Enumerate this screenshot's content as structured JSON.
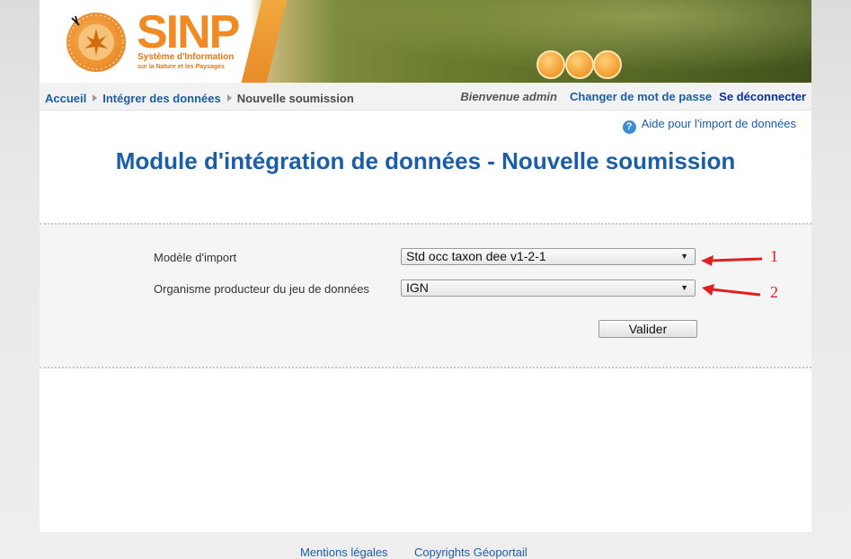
{
  "banner": {
    "logo_text": "SINP",
    "logo_subtitle": "Système d'Information",
    "logo_tagline": "sur la Nature et les Paysages",
    "brand_color": "#f08a24"
  },
  "breadcrumb": {
    "items": [
      {
        "label": "Accueil"
      },
      {
        "label": "Intégrer des données"
      }
    ],
    "current": "Nouvelle soumission"
  },
  "user": {
    "welcome": "Bienvenue admin",
    "change_password": "Changer de mot de passe",
    "logout": "Se déconnecter"
  },
  "help": {
    "label": "Aide pour l'import de données",
    "icon": "help-circle-icon"
  },
  "page": {
    "title": "Module d'intégration de données - Nouvelle soumission"
  },
  "form": {
    "import_model": {
      "label": "Modèle d'import",
      "value": "Std occ taxon dee v1-2-1"
    },
    "producer": {
      "label": "Organisme producteur du jeu de données",
      "value": "IGN"
    },
    "submit_label": "Valider"
  },
  "annotations": [
    "1",
    "2"
  ],
  "footer": {
    "legal": "Mentions légales",
    "copyright": "Copyrights Géoportail"
  },
  "colors": {
    "link": "#1b5ea8",
    "title": "#1b5ea8",
    "annotation": "#e02020"
  }
}
